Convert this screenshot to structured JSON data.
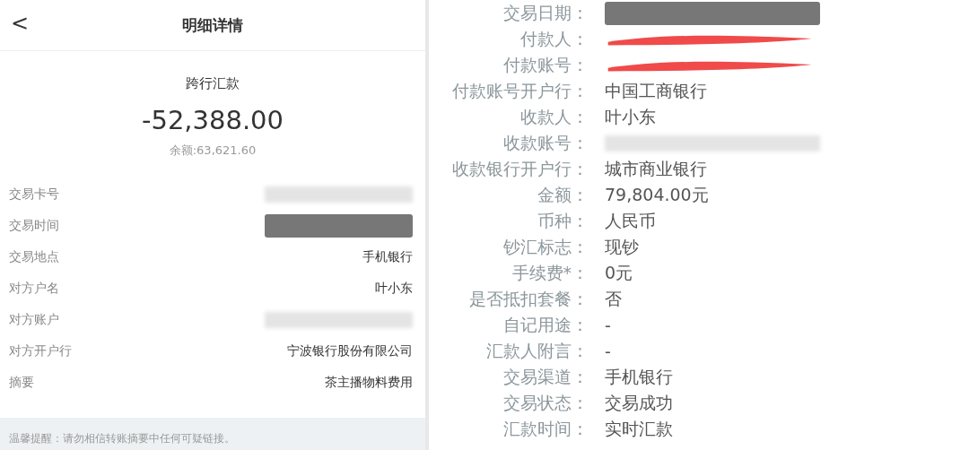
{
  "left_panel": {
    "header": {
      "back": "<",
      "title": "明细详情"
    },
    "summary": {
      "type": "跨行汇款",
      "amount": "-52,388.00",
      "balance": "余额:63,621.60"
    },
    "details": [
      {
        "label": "交易卡号",
        "kind": "blur"
      },
      {
        "label": "交易时间",
        "kind": "redacted"
      },
      {
        "label": "交易地点",
        "kind": "text",
        "value": "手机银行"
      },
      {
        "label": "对方户名",
        "kind": "text",
        "value": "叶小东"
      },
      {
        "label": "对方账户",
        "kind": "blur"
      },
      {
        "label": "对方开户行",
        "kind": "text",
        "value": "宁波银行股份有限公司"
      },
      {
        "label": "摘要",
        "kind": "text",
        "value": "茶主播物料费用"
      }
    ],
    "notice": "温馨提醒：请勿相信转账摘要中任何可疑链接。"
  },
  "right_panel": {
    "rows": [
      {
        "label": "交易日期：",
        "kind": "redacted"
      },
      {
        "label": "付款人：",
        "kind": "scribbled"
      },
      {
        "label": "付款账号：",
        "kind": "scribbled"
      },
      {
        "label": "付款账号开户行：",
        "kind": "text",
        "value": "中国工商银行"
      },
      {
        "label": "收款人：",
        "kind": "text",
        "value": "叶小东"
      },
      {
        "label": "收款账号：",
        "kind": "blur"
      },
      {
        "label": "收款银行开户行：",
        "kind": "text",
        "value": "城市商业银行"
      },
      {
        "label": "金额：",
        "kind": "text",
        "value": "79,804.00元"
      },
      {
        "label": "币种：",
        "kind": "text",
        "value": "人民币"
      },
      {
        "label": "钞汇标志：",
        "kind": "text",
        "value": "现钞"
      },
      {
        "label": "手续费*：",
        "kind": "text",
        "value": "0元"
      },
      {
        "label": "是否抵扣套餐：",
        "kind": "text",
        "value": "否"
      },
      {
        "label": "自记用途：",
        "kind": "text",
        "value": "-"
      },
      {
        "label": "汇款人附言：",
        "kind": "text",
        "value": "-"
      },
      {
        "label": "交易渠道：",
        "kind": "text",
        "value": "手机银行"
      },
      {
        "label": "交易状态：",
        "kind": "text",
        "value": "交易成功"
      },
      {
        "label": "汇款时间：",
        "kind": "text",
        "value": "实时汇款"
      }
    ]
  }
}
